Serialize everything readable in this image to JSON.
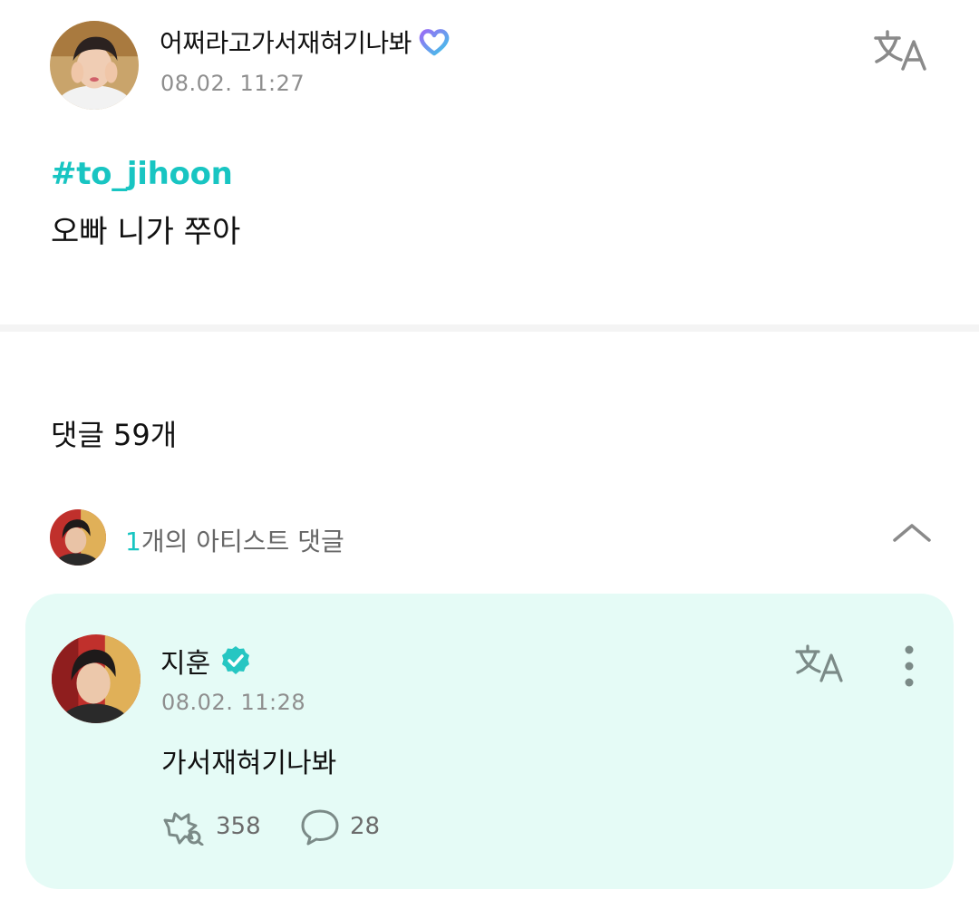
{
  "post": {
    "author": "어쩌라고가서재혀기나봐",
    "timestamp": "08.02. 11:27",
    "hashtag": "#to_jihoon",
    "body": "오빠 니가 쭈아"
  },
  "comments": {
    "count_label": "댓글 59개"
  },
  "artist_summary": {
    "count": "1",
    "label": "개의 아티스트 댓글"
  },
  "artist_comment": {
    "author": "지훈",
    "timestamp": "08.02. 11:28",
    "body": "가서재혀기나봐",
    "likes": "358",
    "replies": "28"
  },
  "icons": {
    "membership": "membership-heart-icon",
    "translate": "translate-icon",
    "chevron": "chevron-up-icon",
    "verified": "verified-badge-icon",
    "more": "more-vertical-icon",
    "like": "clap-like-icon",
    "reply": "comment-bubble-icon"
  },
  "colors": {
    "accent": "#18c5c2",
    "card_background": "#e5fbf6",
    "meta_text": "#8e8e8e",
    "icon_gray": "#7b8a87"
  }
}
